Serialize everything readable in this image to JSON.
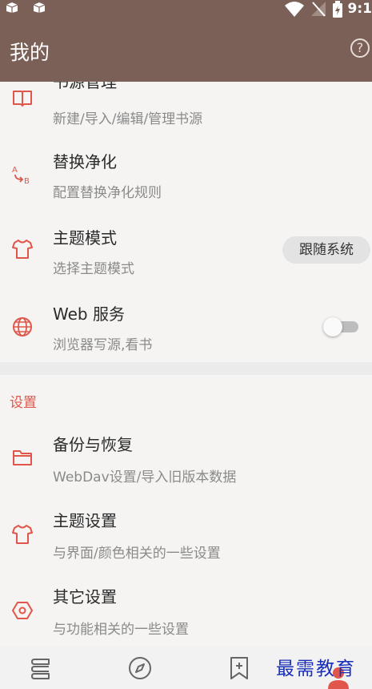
{
  "status_bar": {
    "time": "9:1",
    "left_icons": [
      "notification-box-icon",
      "notification-box-icon"
    ],
    "right_icons": [
      "wifi-icon",
      "signal-icon",
      "battery-charging-icon"
    ]
  },
  "app_bar": {
    "title": "我的",
    "help_icon": "help-circle-icon",
    "help_glyph": "?"
  },
  "rows_top": [
    {
      "title": "书源管理",
      "subtitle": "新建/导入/编辑/管理书源",
      "icon": "book-icon"
    },
    {
      "title": "替换净化",
      "subtitle": "配置替换净化规则",
      "icon": "replace-ab-icon"
    },
    {
      "title": "主题模式",
      "subtitle": "选择主题模式",
      "icon": "shirt-icon",
      "chip": "跟随系统"
    },
    {
      "title": "Web 服务",
      "subtitle": "浏览器写源,看书",
      "icon": "globe-icon",
      "toggle_on": false
    }
  ],
  "section": {
    "label": "设置"
  },
  "rows_settings": [
    {
      "title": "备份与恢复",
      "subtitle": "WebDav设置/导入旧版本数据",
      "icon": "folder-icon"
    },
    {
      "title": "主题设置",
      "subtitle": "与界面/颜色相关的一些设置",
      "icon": "shirt-icon"
    },
    {
      "title": "其它设置",
      "subtitle": "与功能相关的一些设置",
      "icon": "hexagon-gear-icon"
    }
  ],
  "bottom_nav": {
    "icons": [
      "bookshelf-icon",
      "compass-icon",
      "bookmark-add-icon",
      "person-icon"
    ]
  },
  "watermark": "最需教育",
  "colors": {
    "primary": "#7b6058",
    "accent": "#e0564a",
    "background": "#f5f4f3"
  }
}
